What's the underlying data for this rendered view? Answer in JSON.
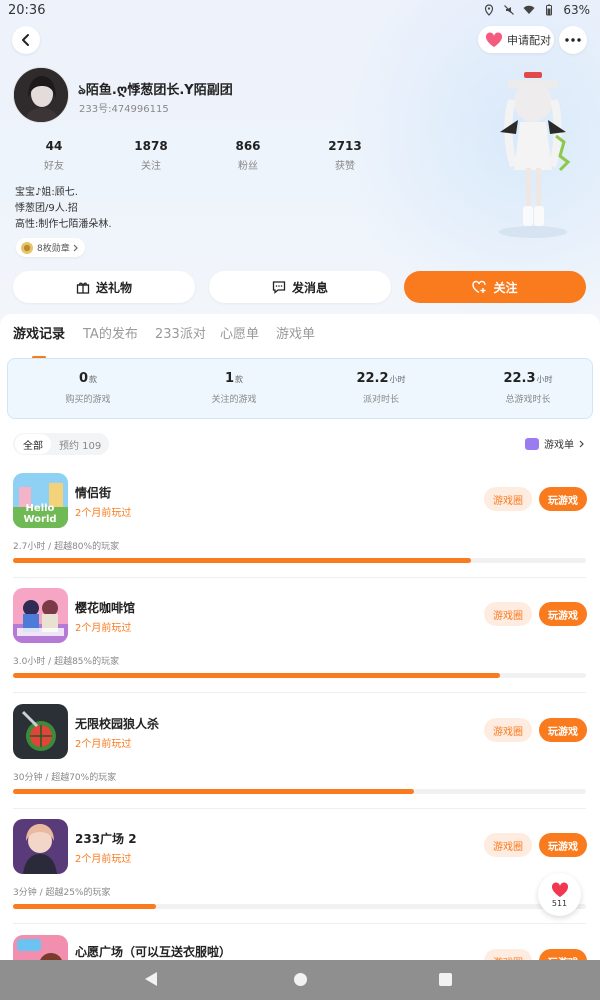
{
  "status_bar": {
    "time": "20:36",
    "battery": "63%"
  },
  "header": {
    "match_label": "申请配对"
  },
  "profile": {
    "nickname": "ঌ陌鱼.ღ悸葱团长.Y陌副团",
    "uid": "233号:474996115",
    "stats": [
      {
        "value": "44",
        "label": "好友"
      },
      {
        "value": "1878",
        "label": "关注"
      },
      {
        "value": "866",
        "label": "粉丝"
      },
      {
        "value": "2713",
        "label": "获赞"
      }
    ],
    "bio_lines": [
      "宝宝♪姐:顾七.",
      "悸葱团/9人.招",
      "高性:制作七陌潘朵林."
    ],
    "badge_label": "8枚勋章"
  },
  "actions": {
    "gift": "送礼物",
    "message": "发消息",
    "follow": "关注"
  },
  "tabs": [
    "游戏记录",
    "TA的发布",
    "233派对",
    "心愿单",
    "游戏单"
  ],
  "summary": [
    {
      "value": "0",
      "unit": "款",
      "label": "购买的游戏"
    },
    {
      "value": "1",
      "unit": "款",
      "label": "关注的游戏"
    },
    {
      "value": "22.2",
      "unit": "小时",
      "label": "派对时长"
    },
    {
      "value": "22.3",
      "unit": "小时",
      "label": "总游戏时长"
    }
  ],
  "filters": {
    "all": "全部",
    "reserve": "预约 109",
    "game_list": "游戏单"
  },
  "games": [
    {
      "name": "情侣街",
      "played": "2个月前玩过",
      "desc": "2.7小时 / 超越80%的玩家",
      "progress": 0.8,
      "circle_label": "游戏圈",
      "play_label": "玩游戏"
    },
    {
      "name": "樱花咖啡馆",
      "played": "2个月前玩过",
      "desc": "3.0小时 / 超越85%的玩家",
      "progress": 0.85,
      "circle_label": "游戏圈",
      "play_label": "玩游戏"
    },
    {
      "name": "无限校园狼人杀",
      "played": "2个月前玩过",
      "desc": "30分钟 / 超越70%的玩家",
      "progress": 0.7,
      "circle_label": "游戏圈",
      "play_label": "玩游戏"
    },
    {
      "name": "233广场 2",
      "played": "2个月前玩过",
      "desc": "3分钟 / 超越25%的玩家",
      "progress": 0.25,
      "circle_label": "游戏圈",
      "play_label": "玩游戏"
    },
    {
      "name": "心愿广场（可以互送衣服啦）",
      "played": "",
      "desc": "",
      "progress": 0,
      "circle_label": "游戏圈",
      "play_label": "玩游戏"
    }
  ],
  "float_heart": {
    "count": "511"
  },
  "colors": {
    "accent": "#fa7a1e",
    "accent_light": "#feece0",
    "summary_bg": "#eef7fd"
  }
}
